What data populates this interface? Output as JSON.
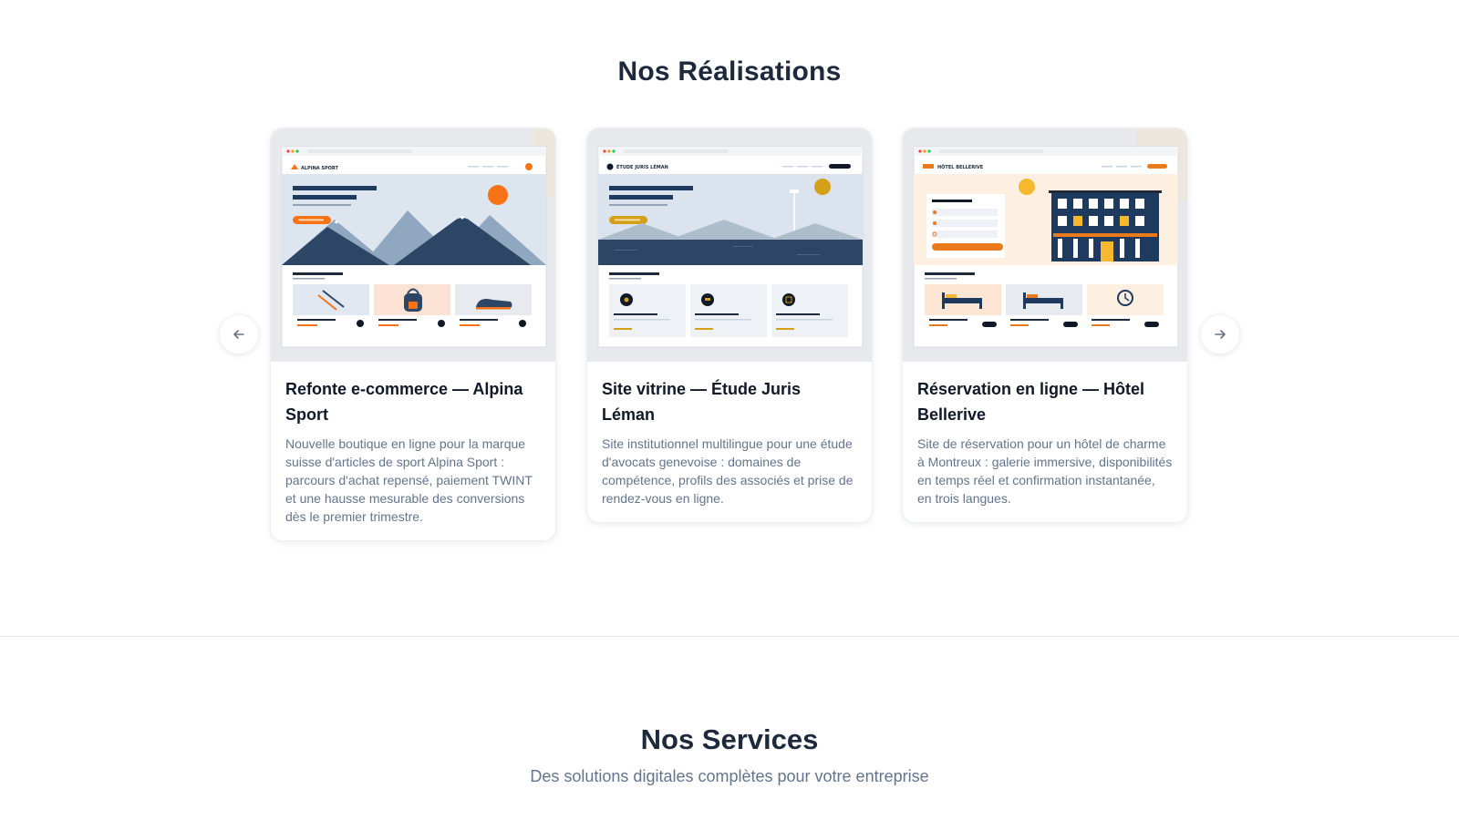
{
  "realisations": {
    "title": "Nos Réalisations",
    "prev_icon": "arrow-left-icon",
    "next_icon": "arrow-right-icon",
    "projects": [
      {
        "title": "Refonte e-commerce — Alpina Sport",
        "description": "Nouvelle boutique en ligne pour la marque suisse d'articles de sport Alpina Sport : parcours d'achat repensé, paiement TWINT et une hausse mesurable des conversions dès le premier trimestre.",
        "mockup_brand": "ALPINA SPORT",
        "accent": "#f97316"
      },
      {
        "title": "Site vitrine — Étude Juris Léman",
        "description": "Site institutionnel multilingue pour une étude d'avocats genevoise : domaines de compétence, profils des associés et prise de rendez-vous en ligne.",
        "mockup_brand": "ÉTUDE JURIS LÉMAN",
        "accent": "#d4a017"
      },
      {
        "title": "Réservation en ligne — Hôtel Bellerive",
        "description": "Site de réservation pour un hôtel de charme à Montreux : galerie immersive, disponibilités en temps réel et confirmation instantanée, en trois langues.",
        "mockup_brand": "HÔTEL BELLERIVE",
        "accent": "#ea7a1c"
      }
    ]
  },
  "services": {
    "title": "Nos Services",
    "subtitle": "Des solutions digitales complètes pour votre entreprise"
  },
  "colors": {
    "heading": "#1e293b",
    "muted": "#64748b",
    "navy": "#1e3a5f",
    "orange": "#f97316"
  }
}
